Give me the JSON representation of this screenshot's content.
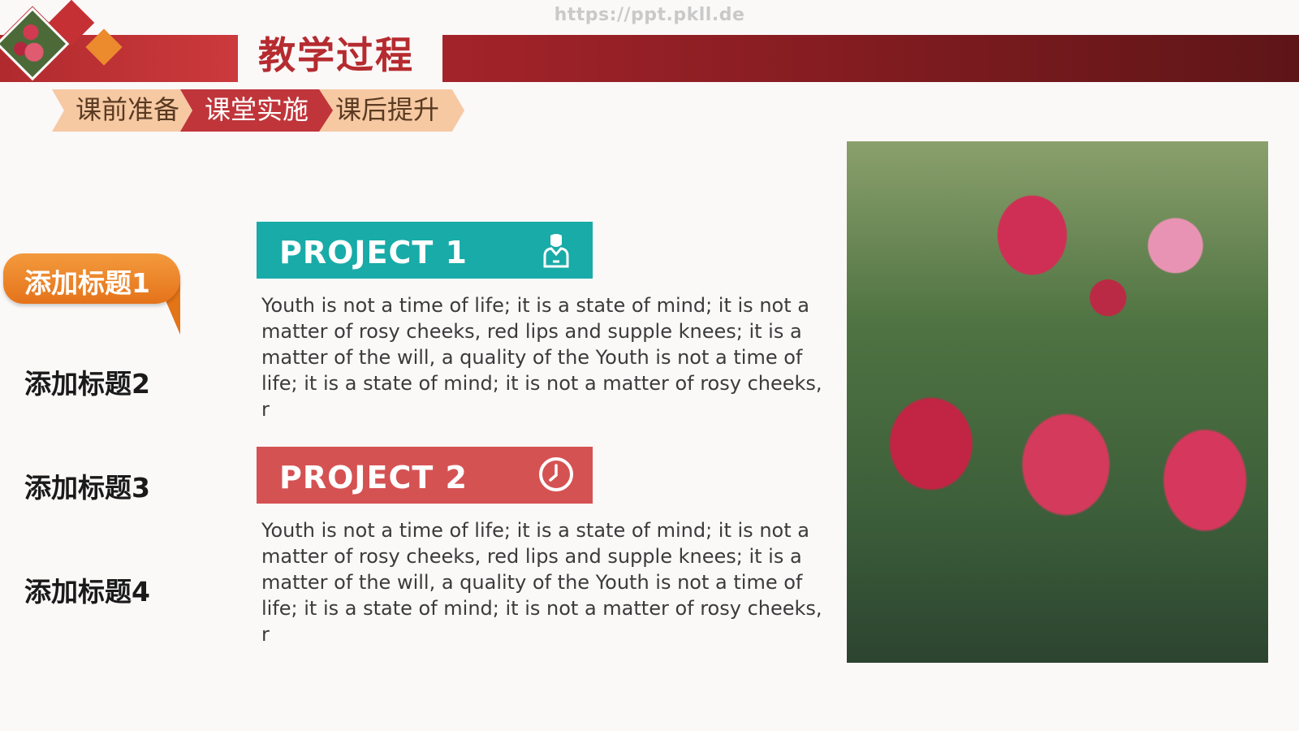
{
  "watermark": "https://ppt.pkll.de",
  "header": {
    "title": "教学过程"
  },
  "tabs": [
    {
      "label": "课前准备",
      "active": false
    },
    {
      "label": "课堂实施",
      "active": true
    },
    {
      "label": "课后提升",
      "active": false
    }
  ],
  "sidebar": {
    "items": [
      {
        "label": "添加标题1",
        "active": true
      },
      {
        "label": "添加标题2",
        "active": false
      },
      {
        "label": "添加标题3",
        "active": false
      },
      {
        "label": "添加标题4",
        "active": false
      }
    ]
  },
  "projects": [
    {
      "title": "PROJECT 1",
      "icon": "person-icon",
      "color": "#18aba8",
      "text": "Youth is not a time of life; it is a state of mind; it is not a matter of rosy cheeks, red lips and supple knees; it is a matter of the will, a quality of the Youth is not a time of life; it is a state of mind; it is not a matter of rosy cheeks, r"
    },
    {
      "title": "PROJECT 2",
      "icon": "clock-icon",
      "color": "#d55253",
      "text": "Youth is not a time of life; it is a state of mind; it is not a matter of rosy cheeks, red lips and supple knees; it is a matter of the will, a quality of the Youth is not a time of life; it is a state of mind; it is not a matter of rosy cheeks, r"
    }
  ],
  "colors": {
    "accent_red": "#c0353a",
    "accent_orange": "#ec8a2e",
    "dark_red": "#5e1517"
  }
}
